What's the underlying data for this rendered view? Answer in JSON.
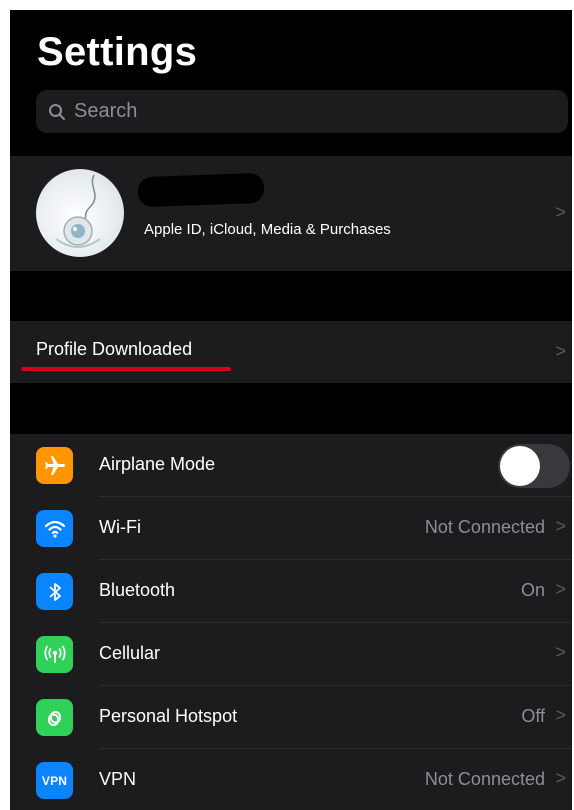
{
  "page": {
    "title": "Settings"
  },
  "search": {
    "placeholder": "Search"
  },
  "profile": {
    "subtitle": "Apple ID, iCloud, Media & Purchases",
    "chevron": ">"
  },
  "alert": {
    "label": "Profile Downloaded",
    "chevron": ">",
    "underline_color": "#d6001c"
  },
  "settings": {
    "rows": [
      {
        "label": "Airplane Mode",
        "icon": "airplane-icon",
        "icon_color": "#ff9500",
        "toggle": false
      },
      {
        "label": "Wi-Fi",
        "icon": "wifi-icon",
        "icon_color": "#0a84ff",
        "value": "Not Connected",
        "chevron": ">"
      },
      {
        "label": "Bluetooth",
        "icon": "bluetooth-icon",
        "icon_color": "#0a84ff",
        "value": "On",
        "chevron": ">"
      },
      {
        "label": "Cellular",
        "icon": "cellular-icon",
        "icon_color": "#30d158",
        "chevron": ">"
      },
      {
        "label": "Personal Hotspot",
        "icon": "hotspot-icon",
        "icon_color": "#30d158",
        "value": "Off",
        "chevron": ">"
      },
      {
        "label": "VPN",
        "icon": "vpn-icon",
        "icon_text": "VPN",
        "icon_color": "#0a84ff",
        "value": "Not Connected",
        "chevron": ">"
      }
    ]
  }
}
